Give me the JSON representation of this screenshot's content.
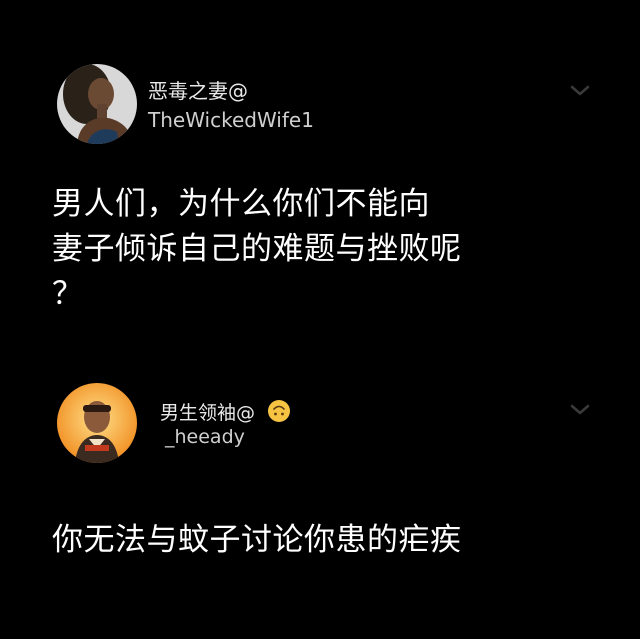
{
  "tweets": [
    {
      "display_name": "恶毒之妻@",
      "handle": "TheWickedWife1",
      "text_lines": [
        "男人们，为什么你们不能向",
        "妻子倾诉自己的难题与挫败呢",
        "？"
      ],
      "avatar_icon": "user-avatar-photo",
      "menu_icon": "chevron-down-icon"
    },
    {
      "display_name": "男生领袖@",
      "handle": "_heeady",
      "text_lines": [
        "你无法与蚊子讨论你患的疟疾"
      ],
      "avatar_icon": "user-avatar-photo",
      "name_emoji": "upside-down-face-emoji",
      "menu_icon": "chevron-down-icon"
    }
  ],
  "colors": {
    "background": "#000000",
    "text": "#ffffff",
    "handle": "#cfcfcf",
    "chevron": "#3a3a3a",
    "emoji": "#f6c343"
  }
}
